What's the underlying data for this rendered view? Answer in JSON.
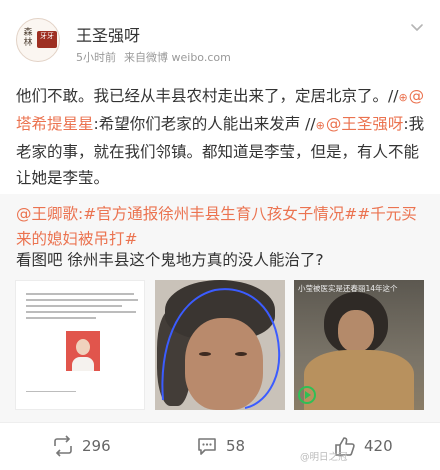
{
  "header": {
    "avatar_chars": {
      "left": "森林",
      "right": "牙牙"
    },
    "username": "王圣强呀",
    "time": "5小时前",
    "source": "来自微博 weibo.com"
  },
  "post": {
    "intro": "他们不敢。我已经从丰县农村走出来了，定居北京了。//",
    "mention1": "@塔希提星星",
    "text1": ":希望你们老家的人能出来发声 //",
    "mention2": "@王圣强呀",
    "text2": ":我老家的事，就在我们邻镇。都知道是李莹，但是，有人不能让她是李莹。"
  },
  "repost": {
    "mention": "@王卿歌",
    "topic1": ":#官方通报徐州丰县生育八孩女子情况#",
    "topic2": "#千元买来的媳妇被吊打#",
    "text": "看图吧 徐州丰县这个鬼地方真的没人能治了?",
    "image3_caption": "小莹被医实是还春丽14年这个"
  },
  "actions": {
    "reposts": "296",
    "comments": "58",
    "likes": "420"
  },
  "watermark": "@明日之冠"
}
